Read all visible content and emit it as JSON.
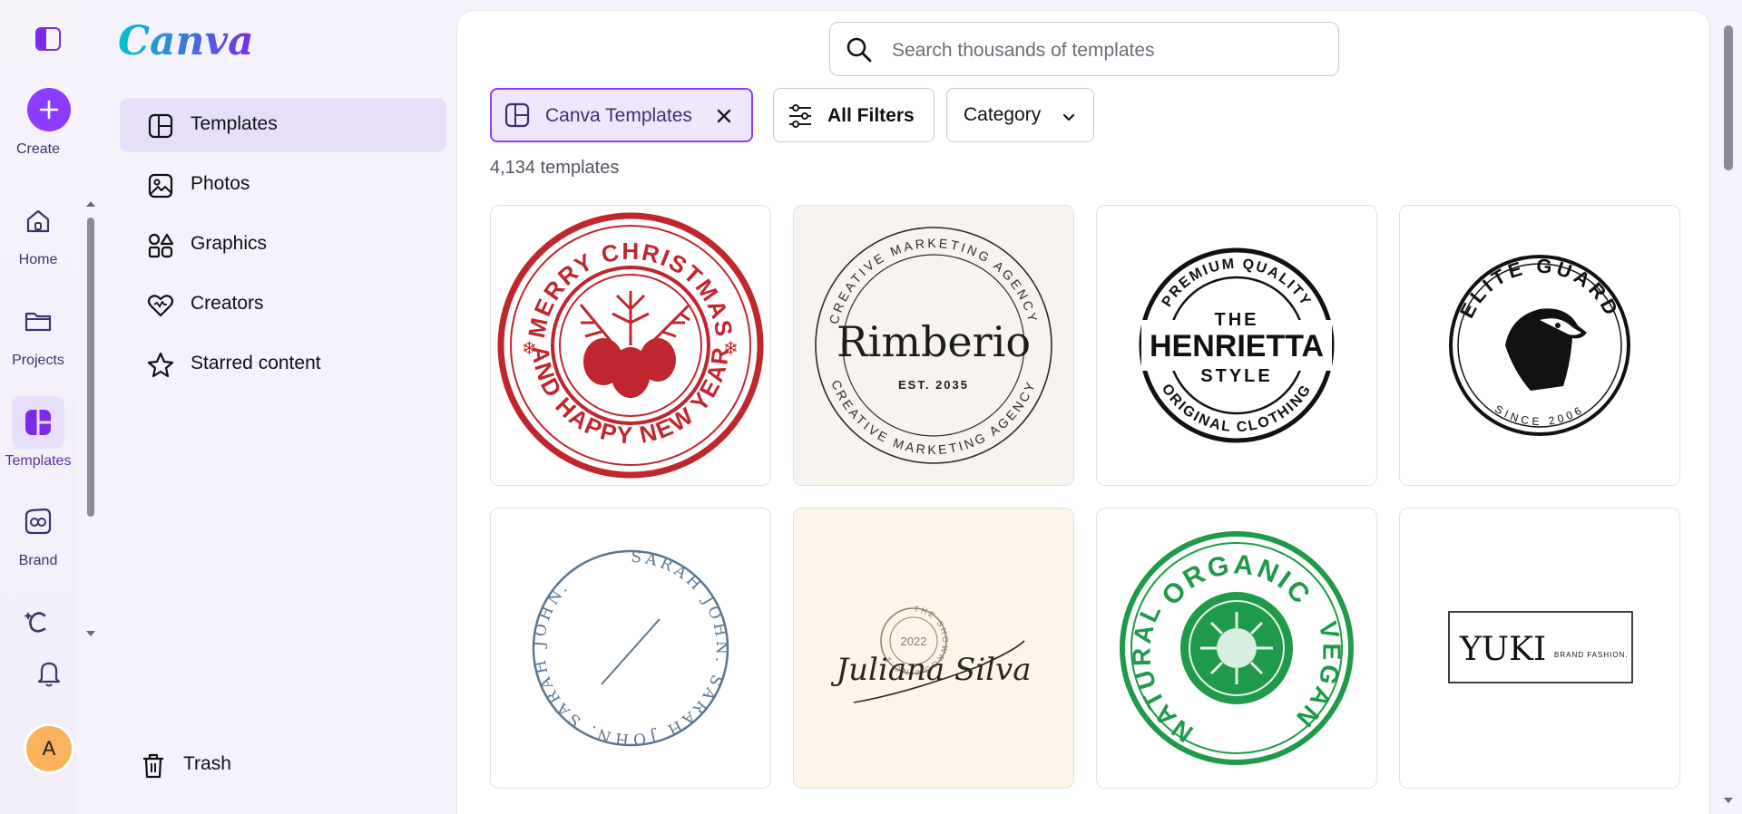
{
  "rail": {
    "create_label": "Create",
    "items": [
      {
        "label": "Home",
        "icon": "home-icon"
      },
      {
        "label": "Projects",
        "icon": "folder-icon"
      },
      {
        "label": "Templates",
        "icon": "templates-icon"
      },
      {
        "label": "Brand",
        "icon": "brand-icon"
      }
    ],
    "avatar_initial": "A"
  },
  "panel": {
    "logo": "Canva",
    "nav": [
      {
        "label": "Templates",
        "icon": "templates-icon"
      },
      {
        "label": "Photos",
        "icon": "photos-icon"
      },
      {
        "label": "Graphics",
        "icon": "graphics-icon"
      },
      {
        "label": "Creators",
        "icon": "heart-icon"
      },
      {
        "label": "Starred content",
        "icon": "star-icon"
      }
    ],
    "trash_label": "Trash"
  },
  "search": {
    "placeholder": "Search thousands of templates"
  },
  "filters": {
    "selected_chip": "Canva Templates",
    "all_filters": "All Filters",
    "category": "Category"
  },
  "count_label": "4,134 templates",
  "templates": [
    {
      "top": "MERRY CHRISTMAS",
      "bottom": "AND HAPPY NEW YEAR",
      "color": "#c0262d"
    },
    {
      "ring_top": "CREATIVE MARKETING AGENCY",
      "name": "Rimberio",
      "sub": "EST. 2035",
      "ring_bottom": "CREATIVE MARKETING AGENCY"
    },
    {
      "top": "PREMIUM QUALITY",
      "line1": "THE",
      "line2": "HENRIETTA",
      "line3": "STYLE",
      "bottom": "ORIGINAL CLOTHING"
    },
    {
      "top": "ELITE GUARD",
      "bottom": "SINCE 2006"
    },
    {
      "ring": "SARAH JOHN. SARAH JOHN. SARAH JOHN.",
      "color": "#5b7591"
    },
    {
      "stamp_top": "THE SHOWROOM NO.1",
      "year": "2022",
      "signature": "Juliana Silva"
    },
    {
      "top": "ORGANIC",
      "left": "NATURAL",
      "right": "VEGAN",
      "color": "#1f9a4a"
    },
    {
      "name": "YUKI",
      "sub": "BRAND FASHION."
    }
  ]
}
